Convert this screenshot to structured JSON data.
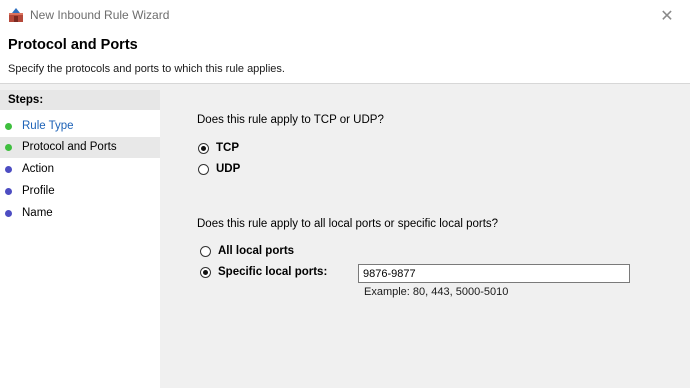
{
  "window": {
    "title": "New Inbound Rule Wizard",
    "icon": "firewall-app-icon",
    "close_glyph": "✕"
  },
  "header": {
    "title": "Protocol and Ports",
    "subtitle": "Specify the protocols and ports to which this rule applies."
  },
  "steps": {
    "label": "Steps:",
    "items": [
      {
        "label": "Rule Type",
        "state": "done"
      },
      {
        "label": "Protocol and Ports",
        "state": "current"
      },
      {
        "label": "Action",
        "state": "pending"
      },
      {
        "label": "Profile",
        "state": "pending"
      },
      {
        "label": "Name",
        "state": "pending"
      }
    ]
  },
  "protocol": {
    "question": "Does this rule apply to TCP or UDP?",
    "options": [
      {
        "label": "TCP",
        "selected": true
      },
      {
        "label": "UDP",
        "selected": false
      }
    ]
  },
  "ports": {
    "question": "Does this rule apply to all local ports or specific local ports?",
    "options": [
      {
        "label": "All local ports",
        "selected": false
      },
      {
        "label": "Specific local ports:",
        "selected": true
      }
    ],
    "value": "9876-9877",
    "example": "Example: 80, 443, 5000-5010"
  },
  "colors": {
    "done_step": "#1d62b7",
    "green_dot": "#3fbf3f",
    "blue_dot": "#4d4dc2"
  }
}
